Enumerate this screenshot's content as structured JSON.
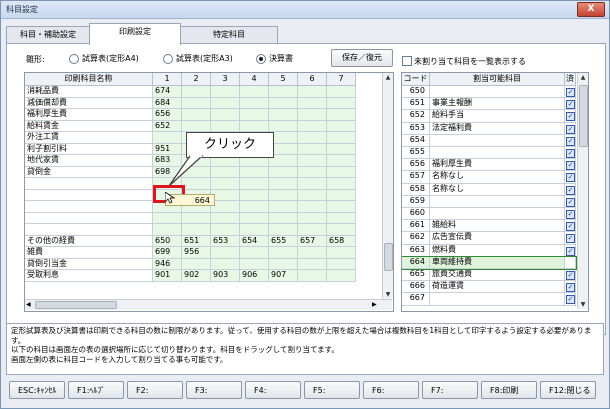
{
  "window": {
    "title": "科目設定",
    "close_label": "X"
  },
  "tabs": [
    {
      "label": "科目・補助設定"
    },
    {
      "label": "印刷設定"
    },
    {
      "label": "特定科目"
    }
  ],
  "form": {
    "label": "雛形:",
    "options": [
      "試算表(定形A4)",
      "試算表(定形A3)",
      "決算書"
    ],
    "selected": 2
  },
  "save_restore_label": "保存／復元",
  "show_unassigned_label": "未割り当て科目を一覧表示する",
  "left_table": {
    "headers": [
      "印刷科目名称",
      "1",
      "2",
      "3",
      "4",
      "5",
      "6",
      "7"
    ],
    "rows": [
      {
        "name": "消耗品費",
        "cols": [
          "674",
          "",
          "",
          "",
          "",
          "",
          ""
        ]
      },
      {
        "name": "減価償却費",
        "cols": [
          "684",
          "",
          "",
          "",
          "",
          "",
          ""
        ]
      },
      {
        "name": "福利厚生費",
        "cols": [
          "656",
          "",
          "",
          "",
          "",
          "",
          ""
        ]
      },
      {
        "name": "給料賃金",
        "cols": [
          "652",
          "",
          "",
          "",
          "",
          "",
          ""
        ]
      },
      {
        "name": "外注工賃",
        "cols": [
          "",
          "",
          "",
          "",
          "",
          "",
          ""
        ]
      },
      {
        "name": "利子割引料",
        "cols": [
          "951",
          "",
          "",
          "",
          "",
          "",
          ""
        ]
      },
      {
        "name": "地代家賃",
        "cols": [
          "683",
          "",
          "",
          "",
          "",
          "",
          ""
        ]
      },
      {
        "name": "貸倒金",
        "cols": [
          "698",
          "",
          "",
          "",
          "",
          "",
          ""
        ]
      },
      {
        "name": "",
        "cols": [
          "",
          "",
          "",
          "",
          "",
          "",
          ""
        ]
      },
      {
        "name": "",
        "cols": [
          "",
          "",
          "",
          "",
          "",
          "",
          ""
        ]
      },
      {
        "name": "",
        "cols": [
          "",
          "",
          "",
          "",
          "",
          "",
          ""
        ]
      },
      {
        "name": "",
        "cols": [
          "",
          "",
          "",
          "",
          "",
          "",
          ""
        ]
      },
      {
        "name": "",
        "cols": [
          "",
          "",
          "",
          "",
          "",
          "",
          ""
        ]
      },
      {
        "name": "その他の経費",
        "cols": [
          "650",
          "651",
          "653",
          "654",
          "655",
          "657",
          "658"
        ]
      },
      {
        "name": "雑費",
        "cols": [
          "699",
          "956",
          "",
          "",
          "",
          "",
          ""
        ]
      },
      {
        "name": "貸倒引当金",
        "cols": [
          "946",
          "",
          "",
          "",
          "",
          "",
          ""
        ]
      },
      {
        "name": "受取利息",
        "cols": [
          "901",
          "902",
          "903",
          "906",
          "907",
          "",
          ""
        ]
      }
    ]
  },
  "drag_value": "664",
  "callout_text": "クリック",
  "right_table": {
    "headers": [
      "コード",
      "割当可能科目",
      "済"
    ],
    "rows": [
      {
        "code": "650",
        "name": "",
        "done": true
      },
      {
        "code": "651",
        "name": "事業主報酬",
        "done": true
      },
      {
        "code": "652",
        "name": "給料手当",
        "done": true
      },
      {
        "code": "653",
        "name": "法定福利費",
        "done": true
      },
      {
        "code": "654",
        "name": "",
        "done": true
      },
      {
        "code": "655",
        "name": "",
        "done": true
      },
      {
        "code": "656",
        "name": "福利厚生費",
        "done": true
      },
      {
        "code": "657",
        "name": "名称なし",
        "done": true
      },
      {
        "code": "658",
        "name": "名称なし",
        "done": true
      },
      {
        "code": "659",
        "name": "",
        "done": true
      },
      {
        "code": "660",
        "name": "",
        "done": true
      },
      {
        "code": "661",
        "name": "雑給料",
        "done": true
      },
      {
        "code": "662",
        "name": "広告宣伝費",
        "done": true
      },
      {
        "code": "663",
        "name": "燃料費",
        "done": true
      },
      {
        "code": "664",
        "name": "車両維持費",
        "done": false
      },
      {
        "code": "665",
        "name": "旅費交通費",
        "done": true
      },
      {
        "code": "666",
        "name": "荷造運賃",
        "done": true
      },
      {
        "code": "667",
        "name": "",
        "done": true
      }
    ],
    "selected_code": "664"
  },
  "description": [
    "定形試算表及び決算書は印刷できる科目の数に制限があります。従って、使用する科目の数が上限を超えた場合は複数科目を1科目として印字するよう設定する必要があります。",
    "以下の科目は画面左の表の選択場所に応じて切り替わります。科目をドラッグして割り当てます。",
    "画面左側の表に科目コードを入力して割り当てる事も可能です。"
  ],
  "fkeys": [
    {
      "label": "ESC:ｷｬﾝｾﾙ"
    },
    {
      "label": "F1:ﾍﾙﾌﾟ"
    },
    {
      "label": "F2:"
    },
    {
      "label": "F3:"
    },
    {
      "label": "F4:"
    },
    {
      "label": "F5:"
    },
    {
      "label": "F6:"
    },
    {
      "label": "F7:"
    },
    {
      "label": "F8:印刷"
    },
    {
      "label": "F12:閉じる"
    }
  ]
}
